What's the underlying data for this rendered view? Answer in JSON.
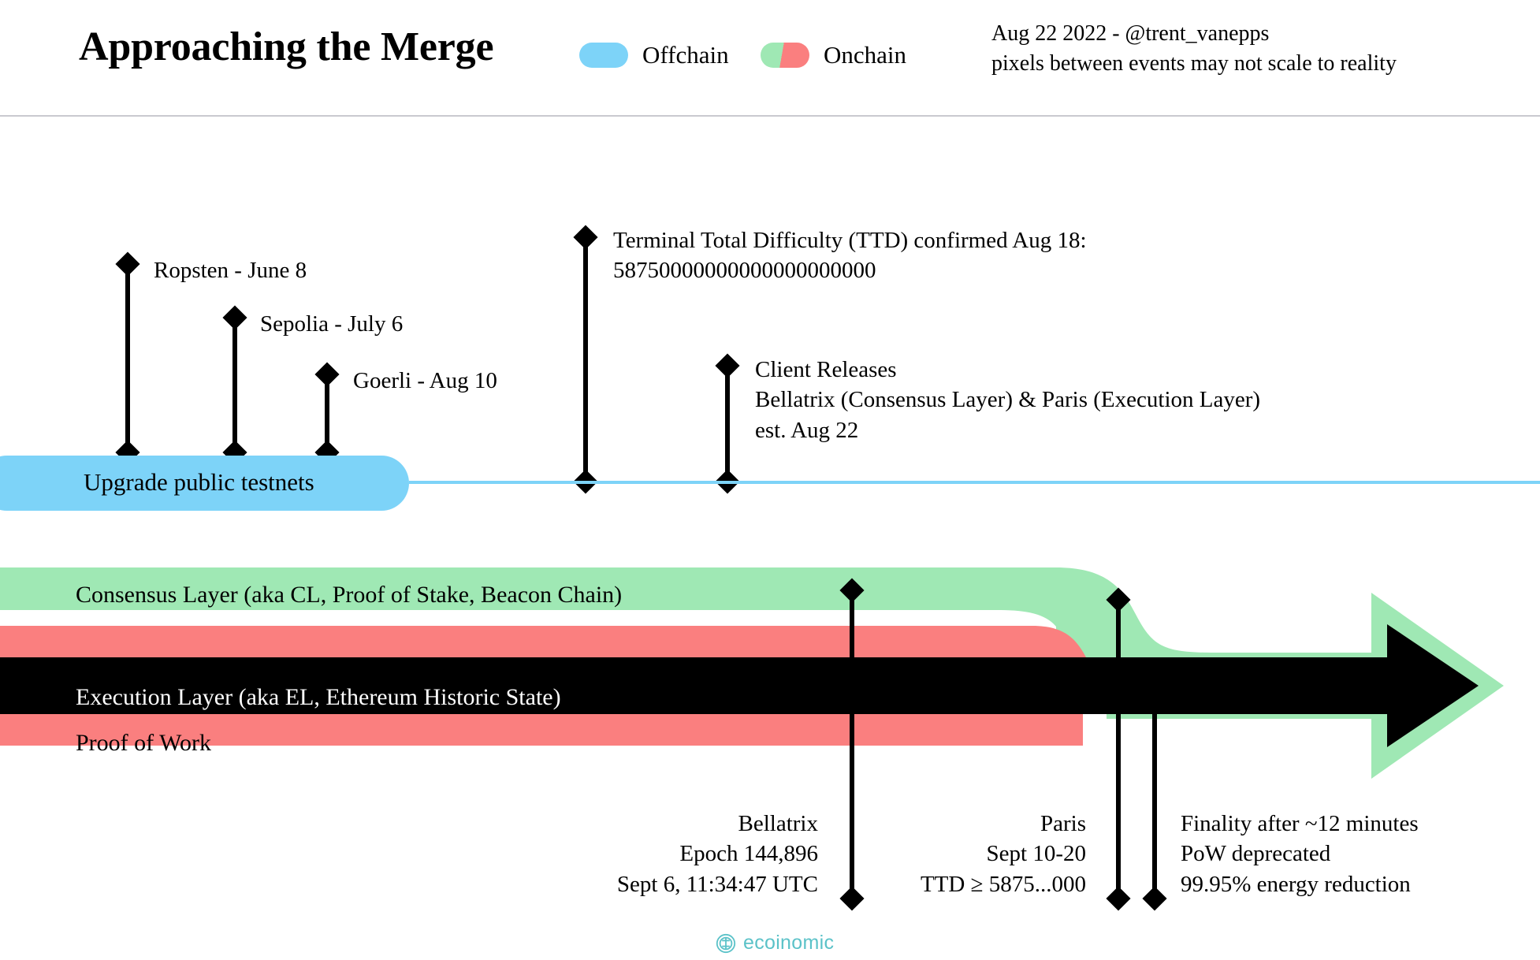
{
  "header": {
    "title": "Approaching the Merge",
    "legend": [
      {
        "label": "Offchain",
        "icon": "offchain-swatch",
        "color": "#7dd3f8"
      },
      {
        "label": "Onchain",
        "icon": "onchain-swatch",
        "color_left": "#9fe8b4",
        "color_right": "#fa7f7f"
      }
    ],
    "meta_line_1": "Aug 22 2022 - @trent_vanepps",
    "meta_line_2": "pixels between events may not scale to reality"
  },
  "offchain_track": {
    "pill_label": "Upgrade public testnets",
    "pill_color": "#7dd3f8",
    "line_color": "#7dd3f8",
    "events": [
      {
        "label": "Ropsten - June 8"
      },
      {
        "label": "Sepolia - July 6"
      },
      {
        "label": "Goerli - Aug 10"
      }
    ],
    "callouts": [
      {
        "line1": "Terminal Total Difficulty (TTD) confirmed Aug 18:",
        "line2": "58750000000000000000000"
      },
      {
        "line1": "Client Releases",
        "line2": "Bellatrix (Consensus Layer) & Paris (Execution Layer)",
        "line3": "est. Aug 22"
      }
    ]
  },
  "onchain_track": {
    "consensus_label": "Consensus Layer (aka CL, Proof of Stake, Beacon Chain)",
    "execution_label": "Execution Layer (aka EL, Ethereum Historic State)",
    "proof_of_work_label": "Proof of Work",
    "consensus_color": "#9fe8b4",
    "execution_color": "#000000",
    "proof_of_work_color": "#fa7f7f",
    "milestones": [
      {
        "name": "bellatrix",
        "line1": "Bellatrix",
        "line2": "Epoch 144,896",
        "line3": "Sept 6, 11:34:47 UTC"
      },
      {
        "name": "paris",
        "line1": "Paris",
        "line2": "Sept 10-20",
        "line3": "TTD ≥ 5875...000"
      },
      {
        "name": "finality",
        "line1": "Finality after ~12 minutes",
        "line2": "PoW deprecated",
        "line3": "99.95% energy reduction"
      }
    ]
  },
  "footer": {
    "logo_text": "ecoinomic",
    "logo_icon": "ecoinomic-logo-icon",
    "logo_color": "#5bc2c8"
  }
}
